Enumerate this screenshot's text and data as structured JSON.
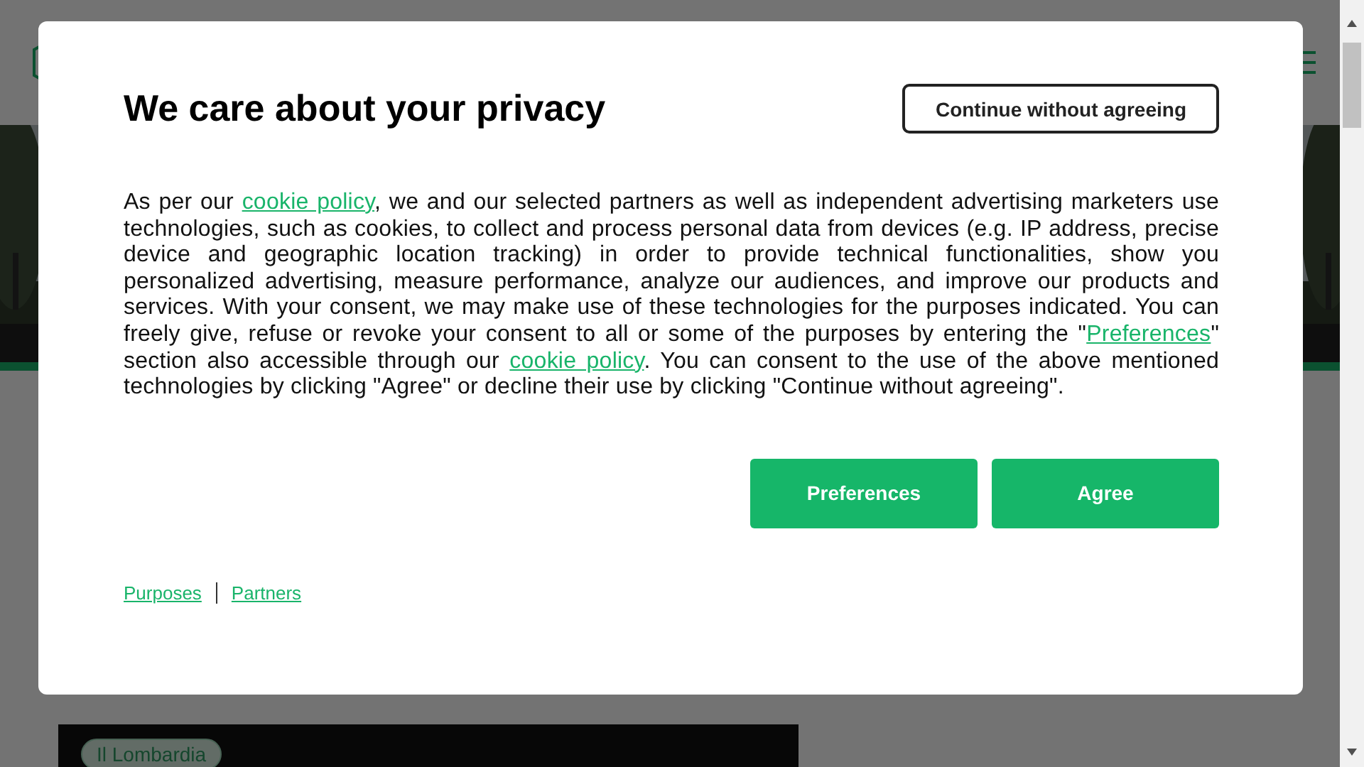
{
  "background_page": {
    "tag": "Il Lombardia"
  },
  "dialog": {
    "title": "We care about your privacy",
    "dismiss_button": "Continue without agreeing",
    "body": [
      {
        "kind": "text",
        "text": "As per our "
      },
      {
        "kind": "link",
        "text": "cookie policy"
      },
      {
        "kind": "text",
        "text": ", we and our selected partners as well as independent advertising marketers use technologies, such as cookies, to collect and process personal data from devices (e.g. IP address, precise device and geographic location tracking) in order to provide technical functionalities, show you personalized advertising, measure performance, analyze our audiences, and improve our products and services. With your consent, we may make use of these technologies for the purposes indicated. You can freely give, refuse or revoke your consent to all or some of the purposes by entering the \""
      },
      {
        "kind": "link",
        "text": "Preferences"
      },
      {
        "kind": "text",
        "text": "\" section also accessible through our "
      },
      {
        "kind": "link",
        "text": "cookie policy"
      },
      {
        "kind": "text",
        "text": ". You can consent to the use of the above mentioned technologies by clicking \"Agree\" or decline their use by clicking \"Continue without agreeing\"."
      }
    ],
    "buttons": [
      "Preferences",
      "Agree"
    ],
    "footer_links": [
      "Purposes",
      "Partners"
    ]
  }
}
